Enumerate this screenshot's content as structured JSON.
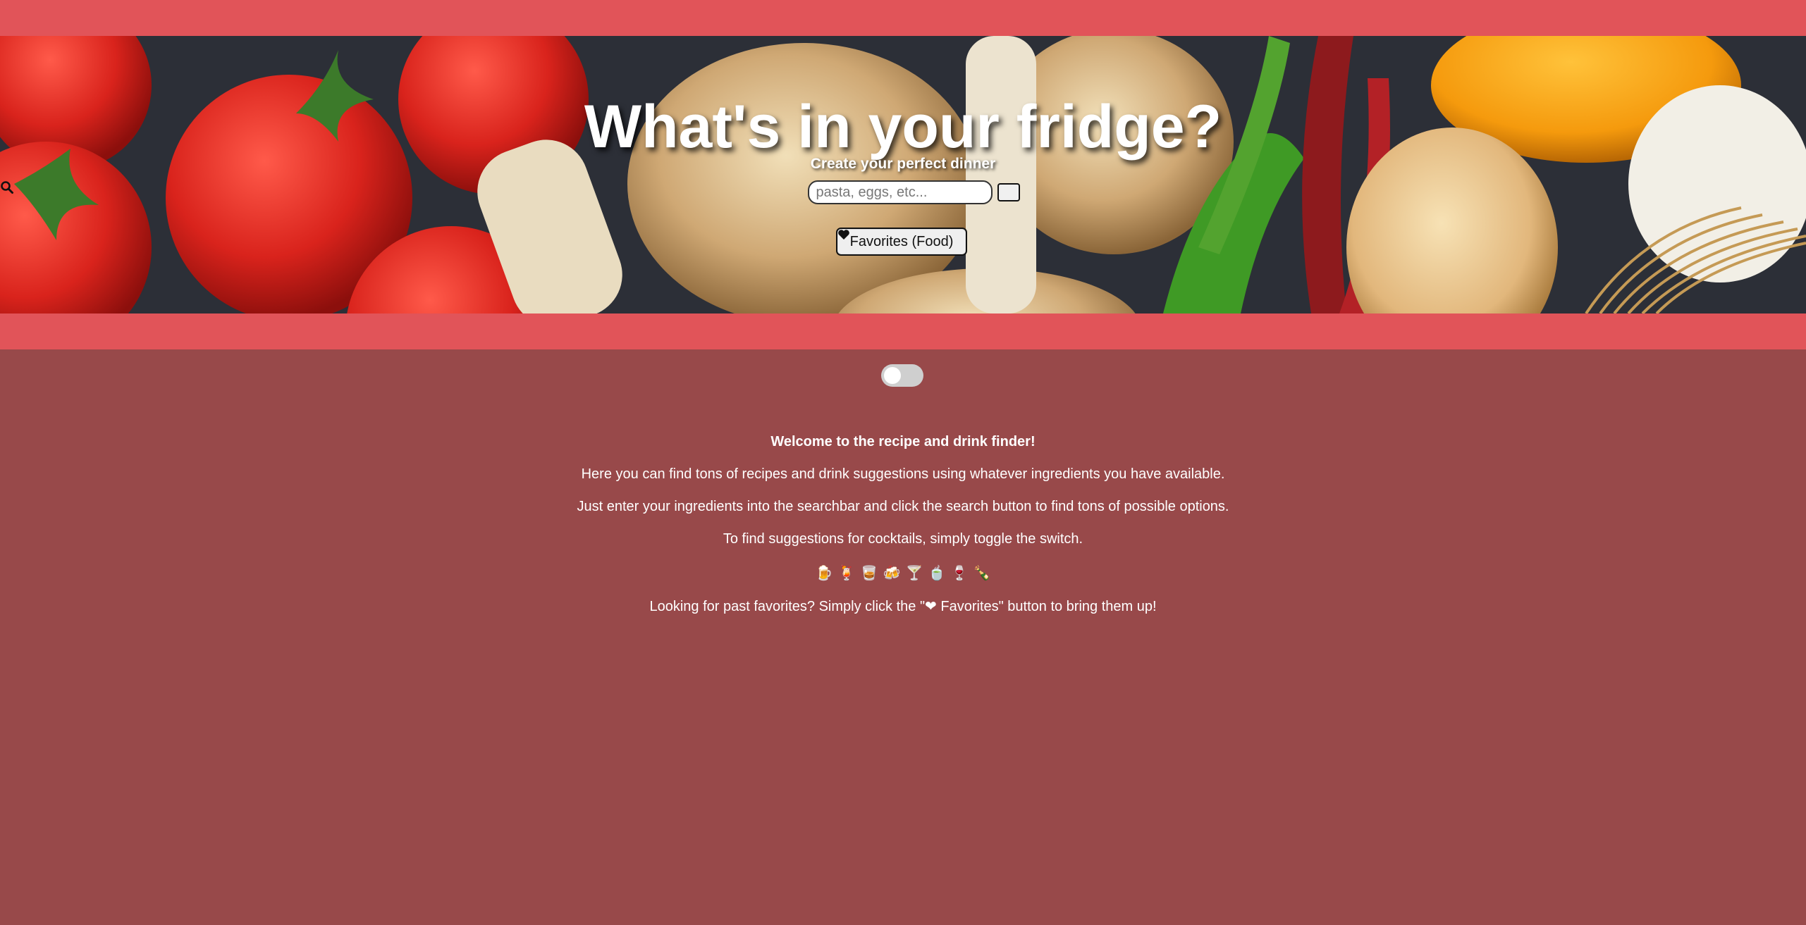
{
  "header": {
    "title": "What's in your fridge?",
    "subtitle": "Create your perfect dinner"
  },
  "search": {
    "placeholder": "pasta, eggs, etc...",
    "value": "",
    "button_icon": "search-icon"
  },
  "favorites_button": {
    "icon": "heart-icon",
    "label": "Favorites (Food)"
  },
  "toggle": {
    "state": "off",
    "mode": "food"
  },
  "intro": {
    "welcome": "Welcome to the recipe and drink finder!",
    "line1": "Here you can find tons of recipes and drink suggestions using whatever ingredients you have available.",
    "line2": "Just enter your ingredients into the searchbar and click the search button to find tons of possible options.",
    "line3": "To find suggestions for cocktails, simply toggle the switch.",
    "emojis": [
      "🍺",
      "🍹",
      "🥃",
      "🍻",
      "🍸",
      "🍵",
      "🍷",
      "🍾"
    ],
    "line4": "Looking for past favorites? Simply click the \"❤ Favorites\" button to bring them up!"
  },
  "colors": {
    "accent_band": "#e15459",
    "page_background": "#98494a",
    "text": "#ffffff"
  }
}
